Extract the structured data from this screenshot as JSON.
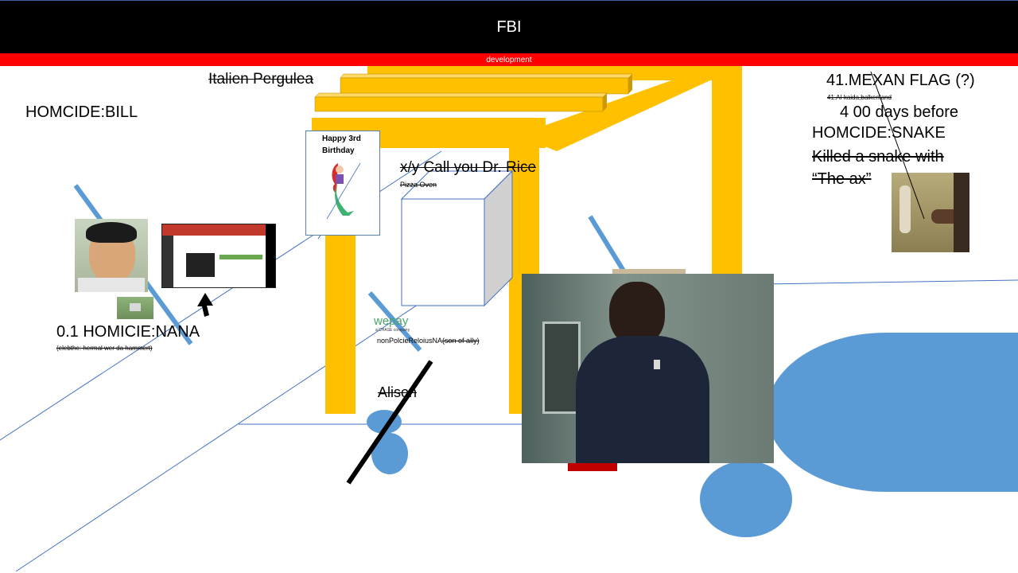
{
  "header": {
    "title": "FBI"
  },
  "devbar": {
    "label": "development"
  },
  "labels": {
    "italien_pergulea": "Italien Pergulea",
    "homicide_bill": "HOMCIDE:BILL",
    "birthday_card": "Happy 3rd Birthday",
    "call_dr_rice": "x/y Call you Dr. Rice",
    "pizza_oven": "Pizza Oven",
    "homicide_nana": "0.1 HOMICIE:NANA",
    "homicide_nana_note": "(elebthe: hermal wer da hammert)",
    "wepay_logo": "wepay",
    "wepay_tagline": "a CHASE company",
    "nonpolicie": "nonPolcieReloiusNA",
    "nonpolicie_strike": "(son of ally)",
    "alison": "Alison",
    "mexan_flag": "41.MEXAN FLAG (?)",
    "mexan_flag_note": "41.Al-kaida,balkenland",
    "days_before": "4 00 days before",
    "homicide_snake": "HOMCIDE:SNAKE",
    "killed_snake": "Killed a snake with",
    "the_ax": "“The ax”"
  },
  "colors": {
    "header_bg": "#000000",
    "devbar_bg": "#ff0000",
    "pergola": "#ffc000",
    "accent_blue": "#5b9bd5",
    "line_blue": "#4472c4"
  },
  "icons": [
    "cursor-arrow-icon",
    "mermaid-icon"
  ]
}
